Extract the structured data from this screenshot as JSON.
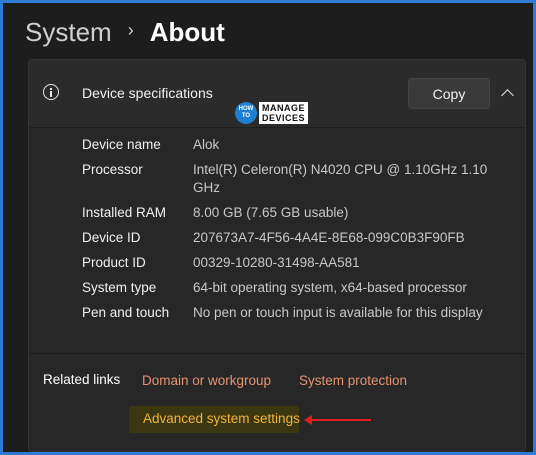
{
  "breadcrumb": {
    "parent": "System",
    "separator": "›",
    "current": "About"
  },
  "device_specs": {
    "title": "Device specifications",
    "copy_label": "Copy",
    "rows": [
      {
        "label": "Device name",
        "value": "Alok"
      },
      {
        "label": "Processor",
        "value": "Intel(R) Celeron(R) N4020 CPU @ 1.10GHz   1.10 GHz"
      },
      {
        "label": "Installed RAM",
        "value": "8.00 GB (7.65 GB usable)"
      },
      {
        "label": "Device ID",
        "value": "207673A7-4F56-4A4E-8E68-099C0B3F90FB"
      },
      {
        "label": "Product ID",
        "value": "00329-10280-31498-AA581"
      },
      {
        "label": "System type",
        "value": "64-bit operating system, x64-based processor"
      },
      {
        "label": "Pen and touch",
        "value": "No pen or touch input is available for this display"
      }
    ]
  },
  "logo": {
    "line1": "HOW",
    "line2": "TO",
    "words_line1": "MANAGE",
    "words_line2": "DEVICES"
  },
  "related": {
    "label": "Related links",
    "links": [
      "Domain or workgroup",
      "System protection",
      "Advanced system settings"
    ]
  },
  "colors": {
    "accent_frame": "#2f7bd6",
    "link": "#e59472",
    "highlight_link": "#f5b33f",
    "arrow": "#e41e1e"
  }
}
